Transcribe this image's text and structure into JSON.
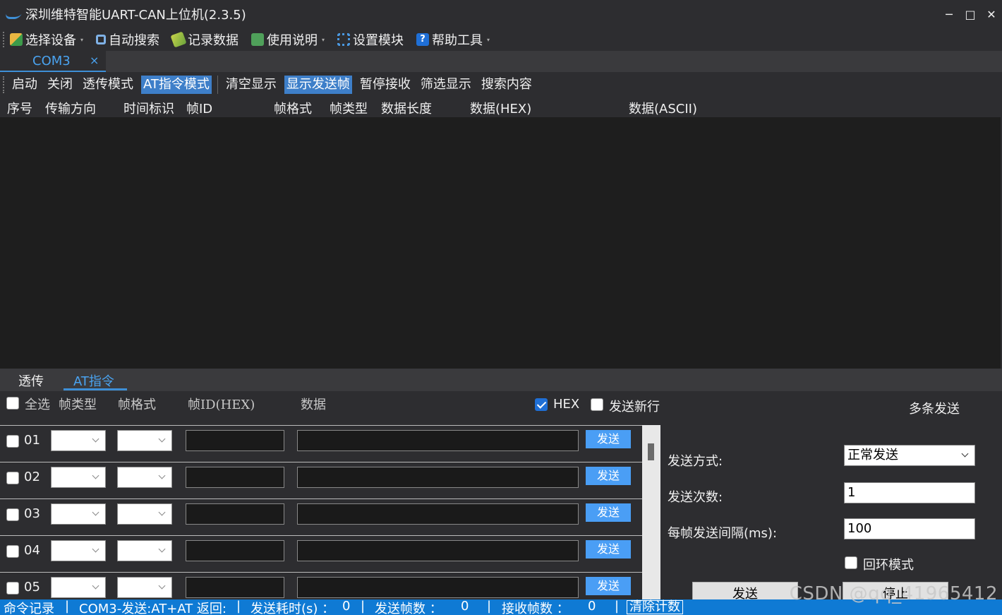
{
  "window": {
    "title": "深圳维特智能UART-CAN上位机(2.3.5)",
    "controls": [
      "─",
      "□",
      "✕"
    ]
  },
  "menu": {
    "items": [
      {
        "label": "选择设备",
        "icon": "device-icon",
        "dropdown": true
      },
      {
        "label": "自动搜索",
        "icon": "search-icon",
        "dropdown": false
      },
      {
        "label": "记录数据",
        "icon": "record-icon",
        "dropdown": false
      },
      {
        "label": "使用说明",
        "icon": "manual-icon",
        "dropdown": true
      },
      {
        "label": "设置模块",
        "icon": "gear-icon",
        "dropdown": false
      },
      {
        "label": "帮助工具",
        "icon": "help-icon",
        "dropdown": true
      }
    ]
  },
  "port_tab": {
    "label": "COM3",
    "close": "×"
  },
  "toolbar": {
    "start": "启动",
    "close": "关闭",
    "passthrough": "透传模式",
    "at_mode": "AT指令模式",
    "clear": "清空显示",
    "show_sent": "显示发送帧",
    "pause": "暂停接收",
    "filter": "筛选显示",
    "search": "搜索内容"
  },
  "grid": {
    "columns": [
      "序号",
      "传输方向",
      "时间标识",
      "帧ID",
      "帧格式",
      "帧类型",
      "数据长度",
      "数据(HEX)",
      "数据(ASCII)"
    ]
  },
  "bottom_tabs": [
    "透传",
    "AT指令"
  ],
  "at_panel": {
    "select_all": "全选",
    "col_frame_type": "帧类型",
    "col_frame_format": "帧格式",
    "col_frame_id": "帧ID(HEX)",
    "col_data": "数据",
    "hex_label": "HEX",
    "hex_checked": true,
    "newline_label": "发送新行",
    "newline_checked": false,
    "multi_send": "多条发送",
    "send_label": "发送",
    "rows": [
      "01",
      "02",
      "03",
      "04",
      "05"
    ]
  },
  "send_settings": {
    "mode_label": "发送方式:",
    "mode_value": "正常发送",
    "count_label": "发送次数:",
    "count_value": "1",
    "interval_label": "每帧发送间隔(ms):",
    "interval_value": "100",
    "loop_label": "回环模式",
    "send_button": "发送",
    "stop_button": "停止"
  },
  "status": {
    "cmd_log": "命令记录",
    "sep": "|",
    "last_cmd": "COM3-发送:AT+AT 返回:",
    "elapsed_label": "发送耗时(s) ：",
    "elapsed_value": "0",
    "sent_label": "发送帧数 ：",
    "sent_value": "0",
    "recv_label": "接收帧数 ：",
    "recv_value": "0",
    "clear_count": "清除计数"
  },
  "watermark": "CSDN @qq_41965412",
  "colors": {
    "accent": "#3e8fd6",
    "active_tab_text": "#4aa3f0",
    "statusbar": "#0f7ad4",
    "send_button": "#4a9ef5"
  }
}
